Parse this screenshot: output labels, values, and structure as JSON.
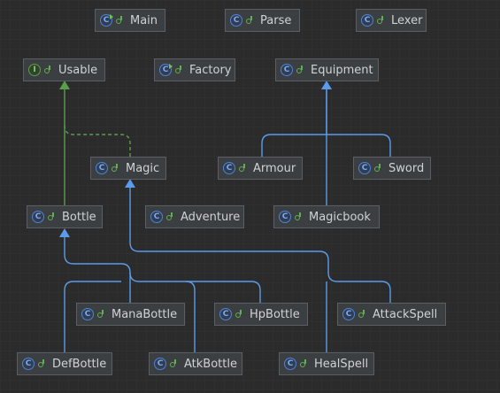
{
  "colors": {
    "inherit": "#5b9bea",
    "implement": "#5a9e4b"
  },
  "nodes": {
    "main": {
      "label": "Main",
      "kind": "class"
    },
    "parse": {
      "label": "Parse",
      "kind": "class"
    },
    "lexer": {
      "label": "Lexer",
      "kind": "class"
    },
    "usable": {
      "label": "Usable",
      "kind": "interface"
    },
    "factory": {
      "label": "Factory",
      "kind": "class"
    },
    "equipment": {
      "label": "Equipment",
      "kind": "class"
    },
    "magic": {
      "label": "Magic",
      "kind": "class"
    },
    "armour": {
      "label": "Armour",
      "kind": "class"
    },
    "sword": {
      "label": "Sword",
      "kind": "class"
    },
    "bottle": {
      "label": "Bottle",
      "kind": "class"
    },
    "adventure": {
      "label": "Adventure",
      "kind": "class"
    },
    "magicbook": {
      "label": "Magicbook",
      "kind": "class"
    },
    "manabottle": {
      "label": "ManaBottle",
      "kind": "class"
    },
    "hpbottle": {
      "label": "HpBottle",
      "kind": "class"
    },
    "attackspell": {
      "label": "AttackSpell",
      "kind": "class"
    },
    "defbottle": {
      "label": "DefBottle",
      "kind": "class"
    },
    "atkbottle": {
      "label": "AtkBottle",
      "kind": "class"
    },
    "healspell": {
      "label": "HealSpell",
      "kind": "class"
    }
  },
  "relations": [
    {
      "from": "bottle",
      "to": "usable",
      "type": "implements"
    },
    {
      "from": "magic",
      "to": "usable",
      "type": "implements"
    },
    {
      "from": "armour",
      "to": "equipment",
      "type": "extends"
    },
    {
      "from": "sword",
      "to": "equipment",
      "type": "extends"
    },
    {
      "from": "magicbook",
      "to": "equipment",
      "type": "extends"
    },
    {
      "from": "manabottle",
      "to": "bottle",
      "type": "extends"
    },
    {
      "from": "hpbottle",
      "to": "bottle",
      "type": "extends"
    },
    {
      "from": "defbottle",
      "to": "bottle",
      "type": "extends"
    },
    {
      "from": "atkbottle",
      "to": "bottle",
      "type": "extends"
    },
    {
      "from": "attackspell",
      "to": "magic",
      "type": "extends"
    },
    {
      "from": "healspell",
      "to": "magic",
      "type": "extends"
    }
  ]
}
